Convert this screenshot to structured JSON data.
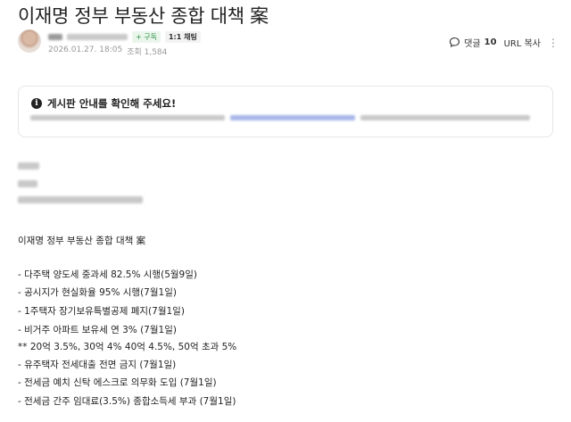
{
  "post": {
    "title": "이재명 정부 부동산 종합 대책 案",
    "follow_label": "+ 구독",
    "chat_label": "1:1 채팅",
    "date": "2026.01.27. 18:05",
    "views_label": "조회 1,584",
    "comment_label": "댓글",
    "comment_count": "10",
    "url_copy_label": "URL 복사",
    "more_label": "⋮"
  },
  "notice": {
    "heading": "게시판 안내를 확인해 주세요!"
  },
  "body": {
    "heading": "이재명 정부 부동산 종합 대책 案",
    "lines": [
      "- 다주택 양도세 중과세 82.5% 시행(5월9일)",
      "- 공시지가 현실화율 95% 시행(7월1일)",
      "- 1주택자 장기보유특별공제 폐지(7월1일)",
      "- 비거주 아파트 보유세 연 3% (7월1일)",
      "** 20억 3.5%, 30억 4% 40억 4.5%, 50억 초과 5%",
      "- 유주택자 전세대출 전면 금지 (7월1일)",
      "- 전세금 예치 신탁 에스크로 의무화 도입 (7월1일)",
      "- 전세금 간주 임대료(3.5%) 종합소득세 부과 (7월1일)"
    ]
  }
}
